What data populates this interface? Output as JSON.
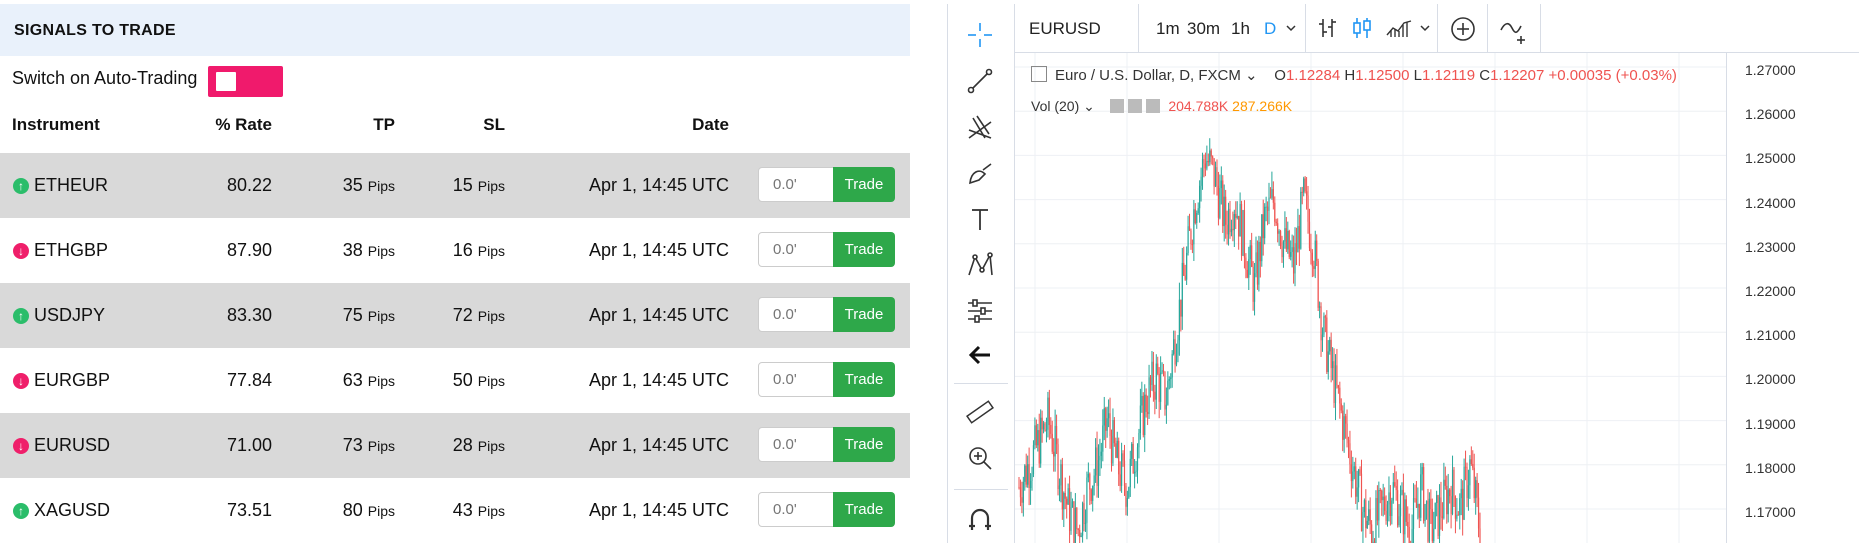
{
  "panel": {
    "title": "SIGNALS TO TRADE",
    "autotrade_label": "Switch on Auto-Trading",
    "columns": {
      "instrument": "Instrument",
      "rate": "% Rate",
      "tp": "TP",
      "sl": "SL",
      "date": "Date"
    },
    "pips_unit": "Pips",
    "trade_label": "Trade",
    "qty_placeholder": "0.0'",
    "rows": [
      {
        "symbol": "ETHEUR",
        "direction": "up",
        "rate": "80.22",
        "tp": "35",
        "sl": "15",
        "date": "Apr 1, 14:45 UTC"
      },
      {
        "symbol": "ETHGBP",
        "direction": "down",
        "rate": "87.90",
        "tp": "38",
        "sl": "16",
        "date": "Apr 1, 14:45 UTC"
      },
      {
        "symbol": "USDJPY",
        "direction": "up",
        "rate": "83.30",
        "tp": "75",
        "sl": "72",
        "date": "Apr 1, 14:45 UTC"
      },
      {
        "symbol": "EURGBP",
        "direction": "down",
        "rate": "77.84",
        "tp": "63",
        "sl": "50",
        "date": "Apr 1, 14:45 UTC"
      },
      {
        "symbol": "EURUSD",
        "direction": "down",
        "rate": "71.00",
        "tp": "73",
        "sl": "28",
        "date": "Apr 1, 14:45 UTC"
      },
      {
        "symbol": "XAGUSD",
        "direction": "up",
        "rate": "73.51",
        "tp": "80",
        "sl": "43",
        "date": "Apr 1, 14:45 UTC"
      }
    ],
    "colors": {
      "toggle": "#f01a6c",
      "trade": "#2ea84a",
      "up": "#2bbd6a",
      "down": "#ef1f6a",
      "header_bg": "#e9f1fb",
      "row_shade": "#d9d9d9"
    }
  },
  "chart": {
    "symbol": "EURUSD",
    "timeframes": [
      "1m",
      "30m",
      "1h",
      "D"
    ],
    "active_timeframe": "D",
    "legend": {
      "name": "Euro / U.S. Dollar, D, FXCM",
      "o_label": "O",
      "o": "1.12284",
      "h_label": "H",
      "h": "1.12500",
      "l_label": "L",
      "l": "1.12119",
      "c_label": "C",
      "c": "1.12207",
      "change": "+0.00035 (+0.03%)"
    },
    "volume": {
      "label": "Vol (20)",
      "v1": "204.788K",
      "v2": "287.266K"
    },
    "price_ticks": [
      "1.27000",
      "1.26000",
      "1.25000",
      "1.24000",
      "1.23000",
      "1.22000",
      "1.21000",
      "1.20000",
      "1.19000",
      "1.18000",
      "1.17000"
    ],
    "colors": {
      "up": "#26a69a",
      "down": "#ef5350",
      "accent": "#2196f3"
    },
    "icons": [
      "crosshair-icon",
      "trend-line-icon",
      "pitchfork-icon",
      "brush-icon",
      "text-icon",
      "pattern-icon",
      "prediction-icon",
      "back-arrow-icon",
      "ruler-icon",
      "zoom-in-icon",
      "magnet-icon",
      "bar-style-icon",
      "candle-style-icon",
      "area-style-icon",
      "compare-icon",
      "indicators-icon"
    ]
  },
  "chart_data": {
    "type": "candlestick",
    "title": "",
    "ylim": [
      1.16,
      1.275
    ],
    "close_path": [
      1.175,
      1.18,
      1.185,
      1.19,
      1.18,
      1.17,
      1.165,
      1.175,
      1.18,
      1.19,
      1.18,
      1.175,
      1.185,
      1.195,
      1.2,
      1.195,
      1.21,
      1.225,
      1.24,
      1.25,
      1.245,
      1.235,
      1.24,
      1.23,
      1.22,
      1.235,
      1.24,
      1.23,
      1.225,
      1.24,
      1.23,
      1.21,
      1.2,
      1.19,
      1.18,
      1.17,
      1.165,
      1.17,
      1.175,
      1.17,
      1.165,
      1.175,
      1.165,
      1.17,
      1.175,
      1.17,
      1.18,
      1.165
    ]
  }
}
